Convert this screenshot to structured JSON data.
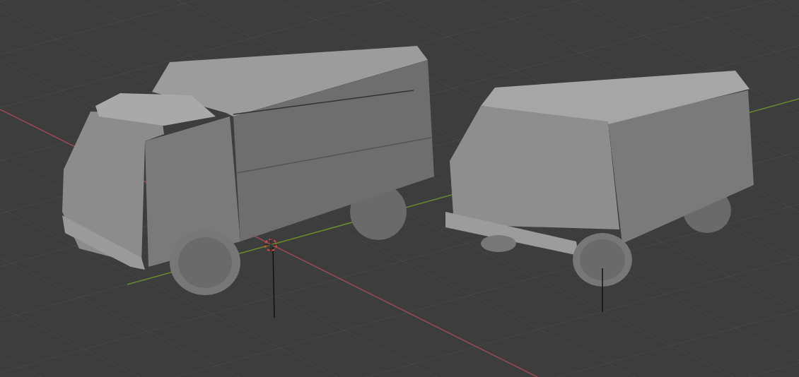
{
  "viewport": {
    "objects": [
      {
        "kind": "truck"
      },
      {
        "kind": "van"
      }
    ]
  }
}
